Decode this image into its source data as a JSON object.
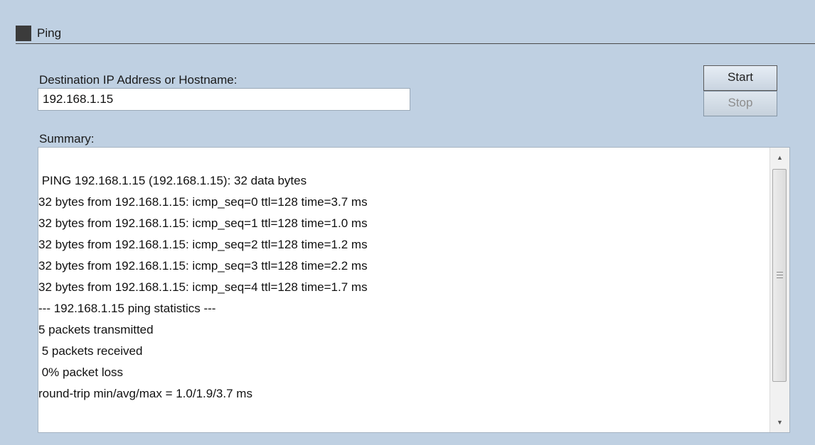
{
  "section": {
    "title": "Ping"
  },
  "form": {
    "destination_label": "Destination IP Address or Hostname:",
    "destination_value": "192.168.1.15"
  },
  "buttons": {
    "start_label": "Start",
    "stop_label": "Stop"
  },
  "summary": {
    "label": "Summary:",
    "lines": [
      " PING 192.168.1.15 (192.168.1.15): 32 data bytes",
      "32 bytes from 192.168.1.15: icmp_seq=0 ttl=128 time=3.7 ms",
      "32 bytes from 192.168.1.15: icmp_seq=1 ttl=128 time=1.0 ms",
      "32 bytes from 192.168.1.15: icmp_seq=2 ttl=128 time=1.2 ms",
      "32 bytes from 192.168.1.15: icmp_seq=3 ttl=128 time=2.2 ms",
      "32 bytes from 192.168.1.15: icmp_seq=4 ttl=128 time=1.7 ms",
      "--- 192.168.1.15 ping statistics ---",
      "5 packets transmitted",
      " 5 packets received",
      " 0% packet loss",
      "round-trip min/avg/max = 1.0/1.9/3.7 ms"
    ]
  },
  "icons": {
    "scroll_up": "scroll-up-arrow-icon",
    "scroll_down": "scroll-down-arrow-icon",
    "section_marker": "section-square-icon"
  }
}
